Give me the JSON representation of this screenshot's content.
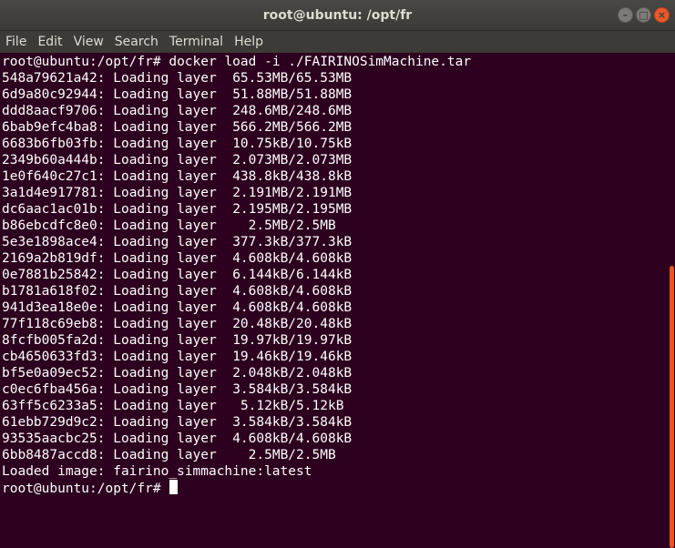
{
  "window": {
    "title": "root@ubuntu: /opt/fr",
    "buttons": {
      "minimize": "–",
      "maximize": "□",
      "close": "×"
    }
  },
  "menu": [
    "File",
    "Edit",
    "View",
    "Search",
    "Terminal",
    "Help"
  ],
  "terminal": {
    "command_prompt": "root@ubuntu:/opt/fr#",
    "command": " docker load -i ./FAIRINOSimMachine.tar",
    "layers": [
      {
        "id": "548a79621a42",
        "status": "Loading layer",
        "progress": "65.53MB/65.53MB",
        "pad": "  "
      },
      {
        "id": "6d9a80c92944",
        "status": "Loading layer",
        "progress": "51.88MB/51.88MB",
        "pad": "  "
      },
      {
        "id": "ddd8aacf9706",
        "status": "Loading layer",
        "progress": "248.6MB/248.6MB",
        "pad": "  "
      },
      {
        "id": "6bab9efc4ba8",
        "status": "Loading layer",
        "progress": "566.2MB/566.2MB",
        "pad": "  "
      },
      {
        "id": "6683b6fb03fb",
        "status": "Loading layer",
        "progress": "10.75kB/10.75kB",
        "pad": "  "
      },
      {
        "id": "2349b60a444b",
        "status": "Loading layer",
        "progress": "2.073MB/2.073MB",
        "pad": "  "
      },
      {
        "id": "1e0f640c27c1",
        "status": "Loading layer",
        "progress": "438.8kB/438.8kB",
        "pad": "  "
      },
      {
        "id": "3a1d4e917781",
        "status": "Loading layer",
        "progress": "2.191MB/2.191MB",
        "pad": "  "
      },
      {
        "id": "dc6aac1ac01b",
        "status": "Loading layer",
        "progress": "2.195MB/2.195MB",
        "pad": "  "
      },
      {
        "id": "b86ebcdfc8e0",
        "status": "Loading layer",
        "progress": "2.5MB/2.5MB",
        "pad": "    "
      },
      {
        "id": "5e3e1898ace4",
        "status": "Loading layer",
        "progress": "377.3kB/377.3kB",
        "pad": "  "
      },
      {
        "id": "2169a2b819df",
        "status": "Loading layer",
        "progress": "4.608kB/4.608kB",
        "pad": "  "
      },
      {
        "id": "0e7881b25842",
        "status": "Loading layer",
        "progress": "6.144kB/6.144kB",
        "pad": "  "
      },
      {
        "id": "b1781a618f02",
        "status": "Loading layer",
        "progress": "4.608kB/4.608kB",
        "pad": "  "
      },
      {
        "id": "941d3ea18e0e",
        "status": "Loading layer",
        "progress": "4.608kB/4.608kB",
        "pad": "  "
      },
      {
        "id": "77f118c69eb8",
        "status": "Loading layer",
        "progress": "20.48kB/20.48kB",
        "pad": "  "
      },
      {
        "id": "8fcfb005fa2d",
        "status": "Loading layer",
        "progress": "19.97kB/19.97kB",
        "pad": "  "
      },
      {
        "id": "cb4650633fd3",
        "status": "Loading layer",
        "progress": "19.46kB/19.46kB",
        "pad": "  "
      },
      {
        "id": "bf5e0a09ec52",
        "status": "Loading layer",
        "progress": "2.048kB/2.048kB",
        "pad": "  "
      },
      {
        "id": "c0ec6fba456a",
        "status": "Loading layer",
        "progress": "3.584kB/3.584kB",
        "pad": "  "
      },
      {
        "id": "63ff5c6233a5",
        "status": "Loading layer",
        "progress": "5.12kB/5.12kB",
        "pad": "   "
      },
      {
        "id": "61ebb729d9c2",
        "status": "Loading layer",
        "progress": "3.584kB/3.584kB",
        "pad": "  "
      },
      {
        "id": "93535aacbc25",
        "status": "Loading layer",
        "progress": "4.608kB/4.608kB",
        "pad": "  "
      },
      {
        "id": "6bb8487accd8",
        "status": "Loading layer",
        "progress": "2.5MB/2.5MB",
        "pad": "    "
      }
    ],
    "loaded_message": "Loaded image: fairino_simmachine:latest",
    "final_prompt": "root@ubuntu:/opt/fr#"
  },
  "colors": {
    "terminal_bg": "#2c001e",
    "text": "#ffffff",
    "titlebar_bg": "#3b3a37",
    "close_button": "#e9592b",
    "scrollbar": "#e95420"
  }
}
